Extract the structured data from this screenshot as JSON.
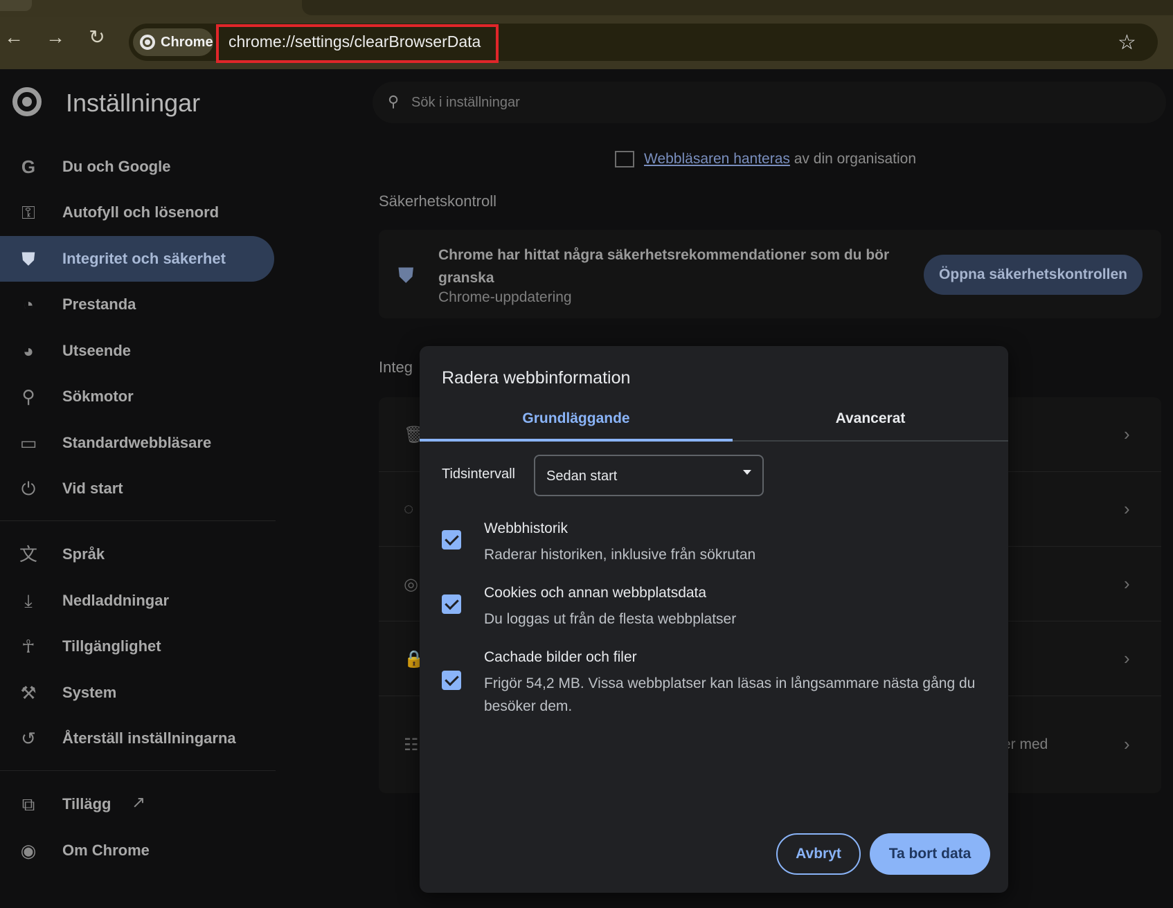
{
  "browser": {
    "chip_label": "Chrome",
    "url": "chrome://settings/clearBrowserData",
    "icons": {
      "back": "back-arrow-icon",
      "forward": "forward-arrow-icon",
      "reload": "reload-icon",
      "bookmark": "star-icon"
    }
  },
  "header": {
    "title": "Inställningar",
    "search_placeholder": "Sök i inställningar"
  },
  "sidebar": {
    "items": [
      {
        "label": "Du och Google",
        "icon": "google-icon"
      },
      {
        "label": "Autofyll och lösenord",
        "icon": "key-icon"
      },
      {
        "label": "Integritet och säkerhet",
        "icon": "shield-icon",
        "active": true
      },
      {
        "label": "Prestanda",
        "icon": "speedometer-icon"
      },
      {
        "label": "Utseende",
        "icon": "palette-icon"
      },
      {
        "label": "Sökmotor",
        "icon": "search-icon"
      },
      {
        "label": "Standardwebbläsare",
        "icon": "browser-window-icon"
      },
      {
        "label": "Vid start",
        "icon": "power-icon"
      },
      {
        "label": "Språk",
        "icon": "translate-icon"
      },
      {
        "label": "Nedladdningar",
        "icon": "download-icon"
      },
      {
        "label": "Tillgänglighet",
        "icon": "accessibility-icon"
      },
      {
        "label": "System",
        "icon": "wrench-icon"
      },
      {
        "label": "Återställ inställningarna",
        "icon": "reset-icon"
      },
      {
        "label": "Tillägg",
        "icon": "extension-icon"
      },
      {
        "label": "Om Chrome",
        "icon": "chrome-icon"
      }
    ]
  },
  "main": {
    "managed_link": "Webbläsaren hanteras",
    "managed_rest": " av din organisation",
    "safety_heading": "Säkerhetskontroll",
    "safety_text": "Chrome har hittat några säkerhetsrekommendationer som du bör granska",
    "safety_sub": "Chrome-uppdatering",
    "safety_button": "Öppna säkerhetskontrollen",
    "privacy_heading": "Integ",
    "privacy_tail": "er med"
  },
  "dialog": {
    "title": "Radera webbinformation",
    "tabs": [
      {
        "label": "Grundläggande",
        "active": true
      },
      {
        "label": "Avancerat"
      }
    ],
    "range_label": "Tidsintervall",
    "range_value": "Sedan start",
    "options": [
      {
        "title": "Webbhistorik",
        "desc": "Raderar historiken, inklusive från sökrutan",
        "checked": true
      },
      {
        "title": "Cookies och annan webbplatsdata",
        "desc": "Du loggas ut från de flesta webbplatser",
        "checked": true
      },
      {
        "title": "Cachade bilder och filer",
        "desc": "Frigör 54,2 MB. Vissa webbplatser kan läsas in långsammare nästa gång du besöker dem.",
        "checked": true
      }
    ],
    "cancel": "Avbryt",
    "confirm": "Ta bort data"
  }
}
